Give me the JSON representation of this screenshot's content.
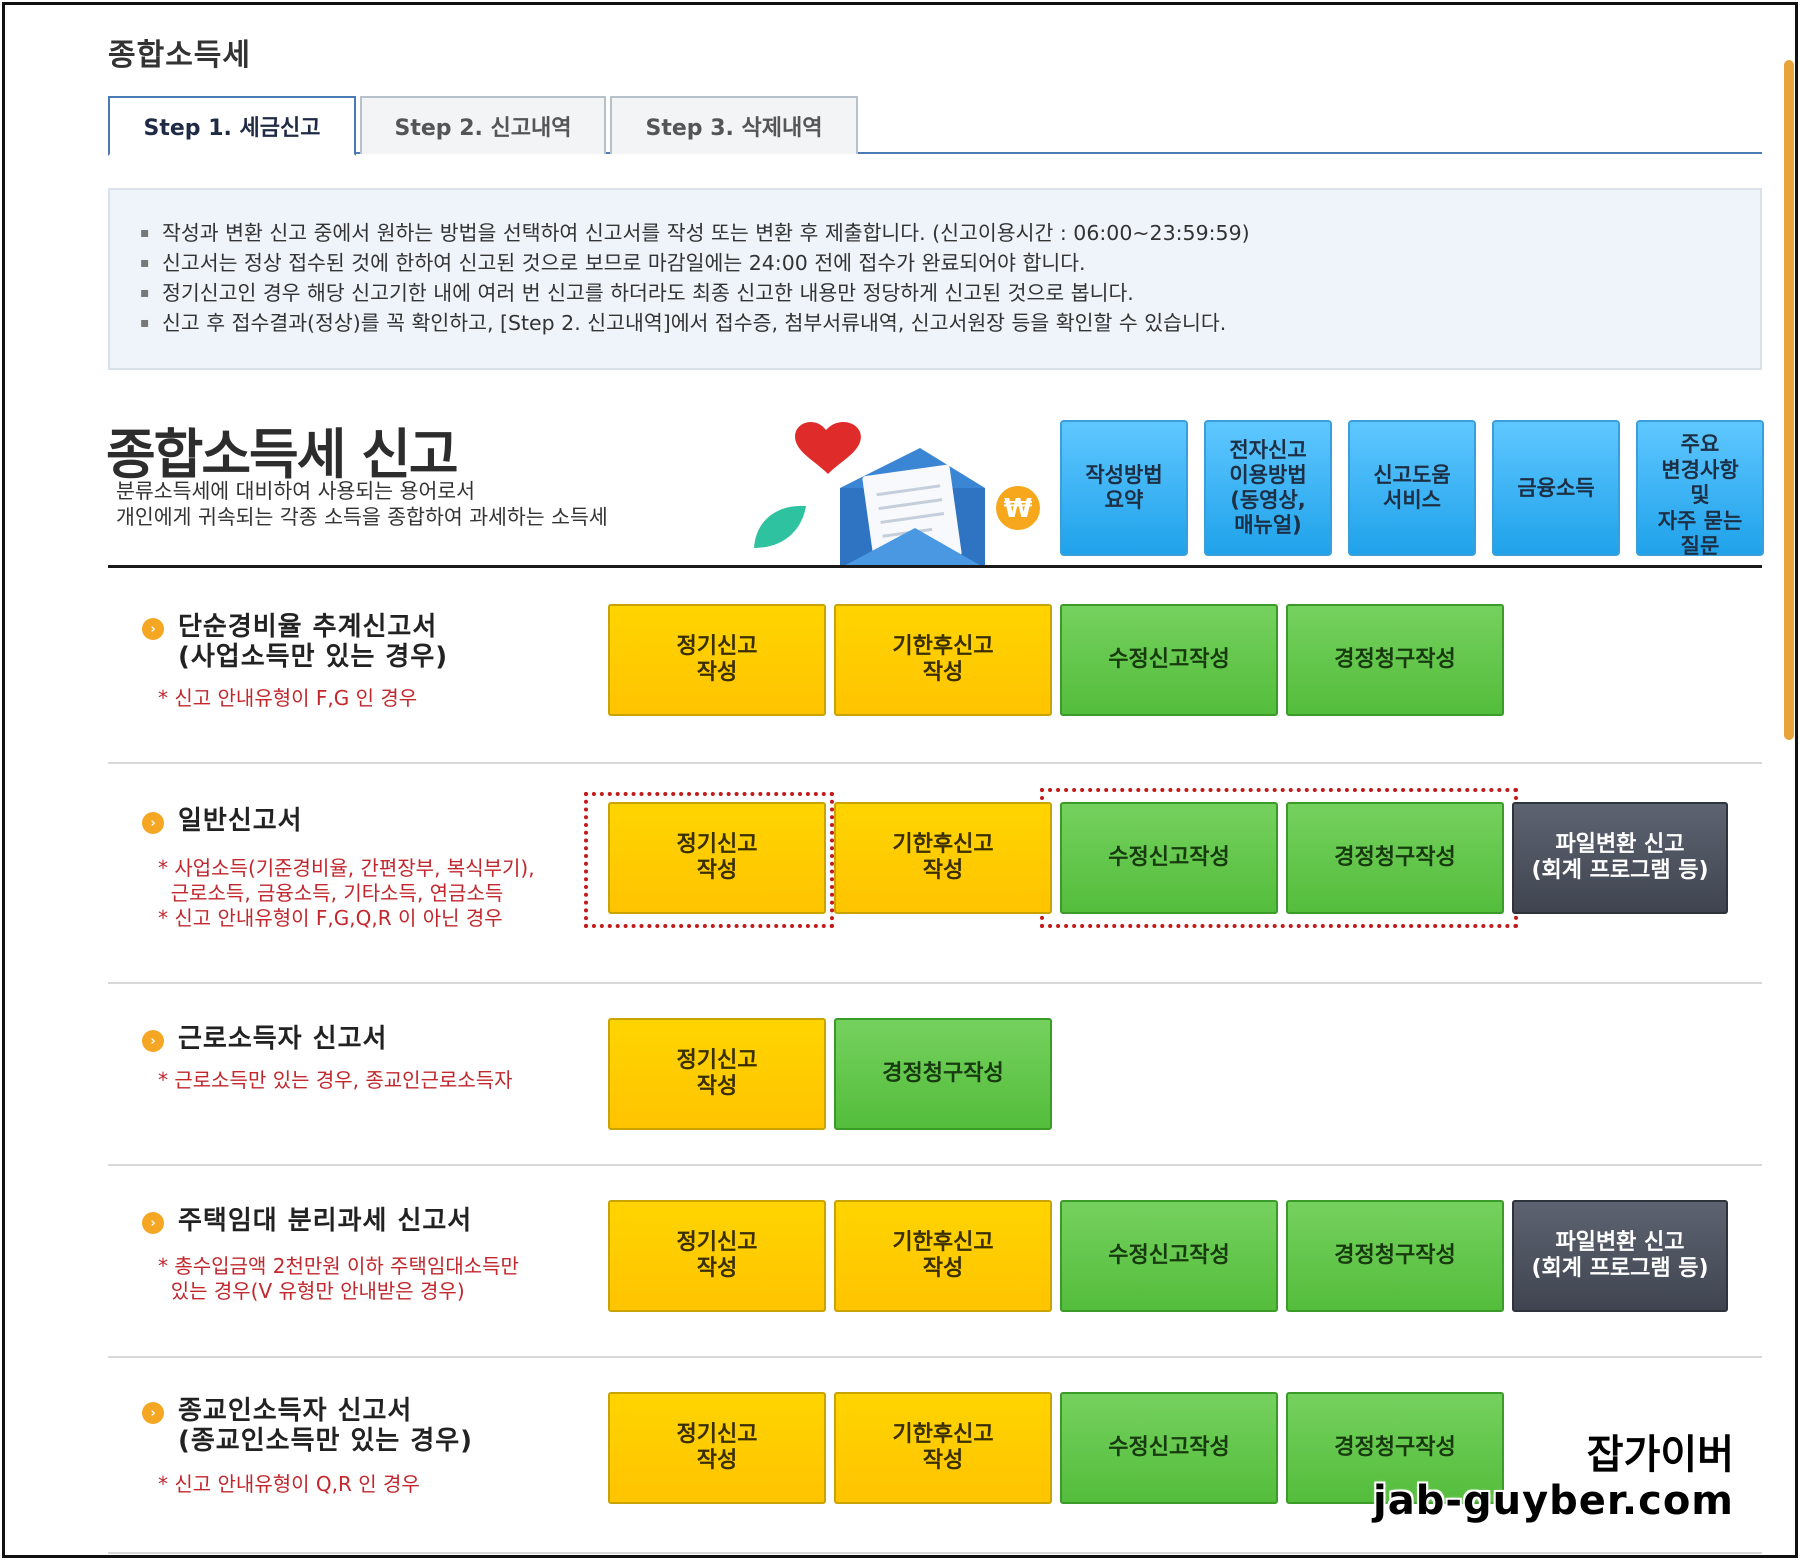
{
  "page_title": "종합소득세",
  "tabs": [
    {
      "label": "Step 1. 세금신고"
    },
    {
      "label": "Step 2. 신고내역"
    },
    {
      "label": "Step 3. 삭제내역"
    }
  ],
  "notice": [
    "작성과 변환 신고 중에서 원하는 방법을 선택하여 신고서를 작성 또는 변환 후 제출합니다. (신고이용시간 : 06:00~23:59:59)",
    "신고서는 정상 접수된 것에 한하여 신고된 것으로 보므로 마감일에는 24:00 전에 접수가 완료되어야 합니다.",
    "정기신고인 경우 해당 신고기한 내에 여러 번 신고를 하더라도 최종 신고한 내용만 정당하게 신고된 것으로 봅니다.",
    "신고 후 접수결과(정상)를 꼭 확인하고, [Step 2. 신고내역]에서 접수증, 첨부서류내역, 신고서원장 등을 확인할 수 있습니다."
  ],
  "hero": {
    "title": "종합소득세 신고",
    "subtitle_line1": "분류소득세에 대비하여 사용되는 용어로서",
    "subtitle_line2": "개인에게 귀속되는 각종 소득을 종합하여 과세하는 소득세"
  },
  "quick_links": [
    {
      "label": "작성방법\n요약"
    },
    {
      "label": "전자신고\n이용방법\n(동영상,\n매뉴얼)"
    },
    {
      "label": "신고도움\n서비스"
    },
    {
      "label": "금융소득"
    },
    {
      "label": "주요\n변경사항\n및\n자주 묻는\n질문"
    }
  ],
  "sections": [
    {
      "title": "단순경비율 추계신고서\n(사업소득만 있는 경우)",
      "notes": [
        "* 신고 안내유형이 F,G 인 경우"
      ],
      "buttons": [
        "정기신고\n작성",
        "기한후신고\n작성",
        "수정신고작성",
        "경정청구작성"
      ]
    },
    {
      "title": "일반신고서",
      "notes": [
        "* 사업소득(기준경비율, 간편장부, 복식부기),",
        "  근로소득, 금융소득, 기타소득, 연금소득",
        "* 신고 안내유형이 F,G,Q,R 이 아닌 경우"
      ],
      "buttons": [
        "정기신고\n작성",
        "기한후신고\n작성",
        "수정신고작성",
        "경정청구작성",
        "파일변환 신고\n(회계 프로그램 등)"
      ]
    },
    {
      "title": "근로소득자 신고서",
      "notes": [
        "* 근로소득만 있는 경우, 종교인근로소득자"
      ],
      "buttons": [
        "정기신고\n작성",
        "경정청구작성"
      ]
    },
    {
      "title": "주택임대 분리과세 신고서",
      "notes": [
        "* 총수입금액 2천만원 이하 주택임대소득만",
        "  있는 경우(V 유형만 안내받은 경우)"
      ],
      "buttons": [
        "정기신고\n작성",
        "기한후신고\n작성",
        "수정신고작성",
        "경정청구작성",
        "파일변환 신고\n(회계 프로그램 등)"
      ]
    },
    {
      "title": "종교인소득자 신고서\n(종교인소득만 있는 경우)",
      "notes": [
        "* 신고 안내유형이 Q,R 인 경우"
      ],
      "buttons": [
        "정기신고\n작성",
        "기한후신고\n작성",
        "수정신고작성",
        "경정청구작성"
      ]
    }
  ],
  "watermark": {
    "line1": "잡가이버",
    "line2": "jab-guyber.com"
  },
  "colors": {
    "accent_blue": "#4a7bb5",
    "yellow_button": "#ffc400",
    "green_button": "#54bd3c",
    "dark_button": "#3f4450",
    "note_red": "#c1272d"
  }
}
